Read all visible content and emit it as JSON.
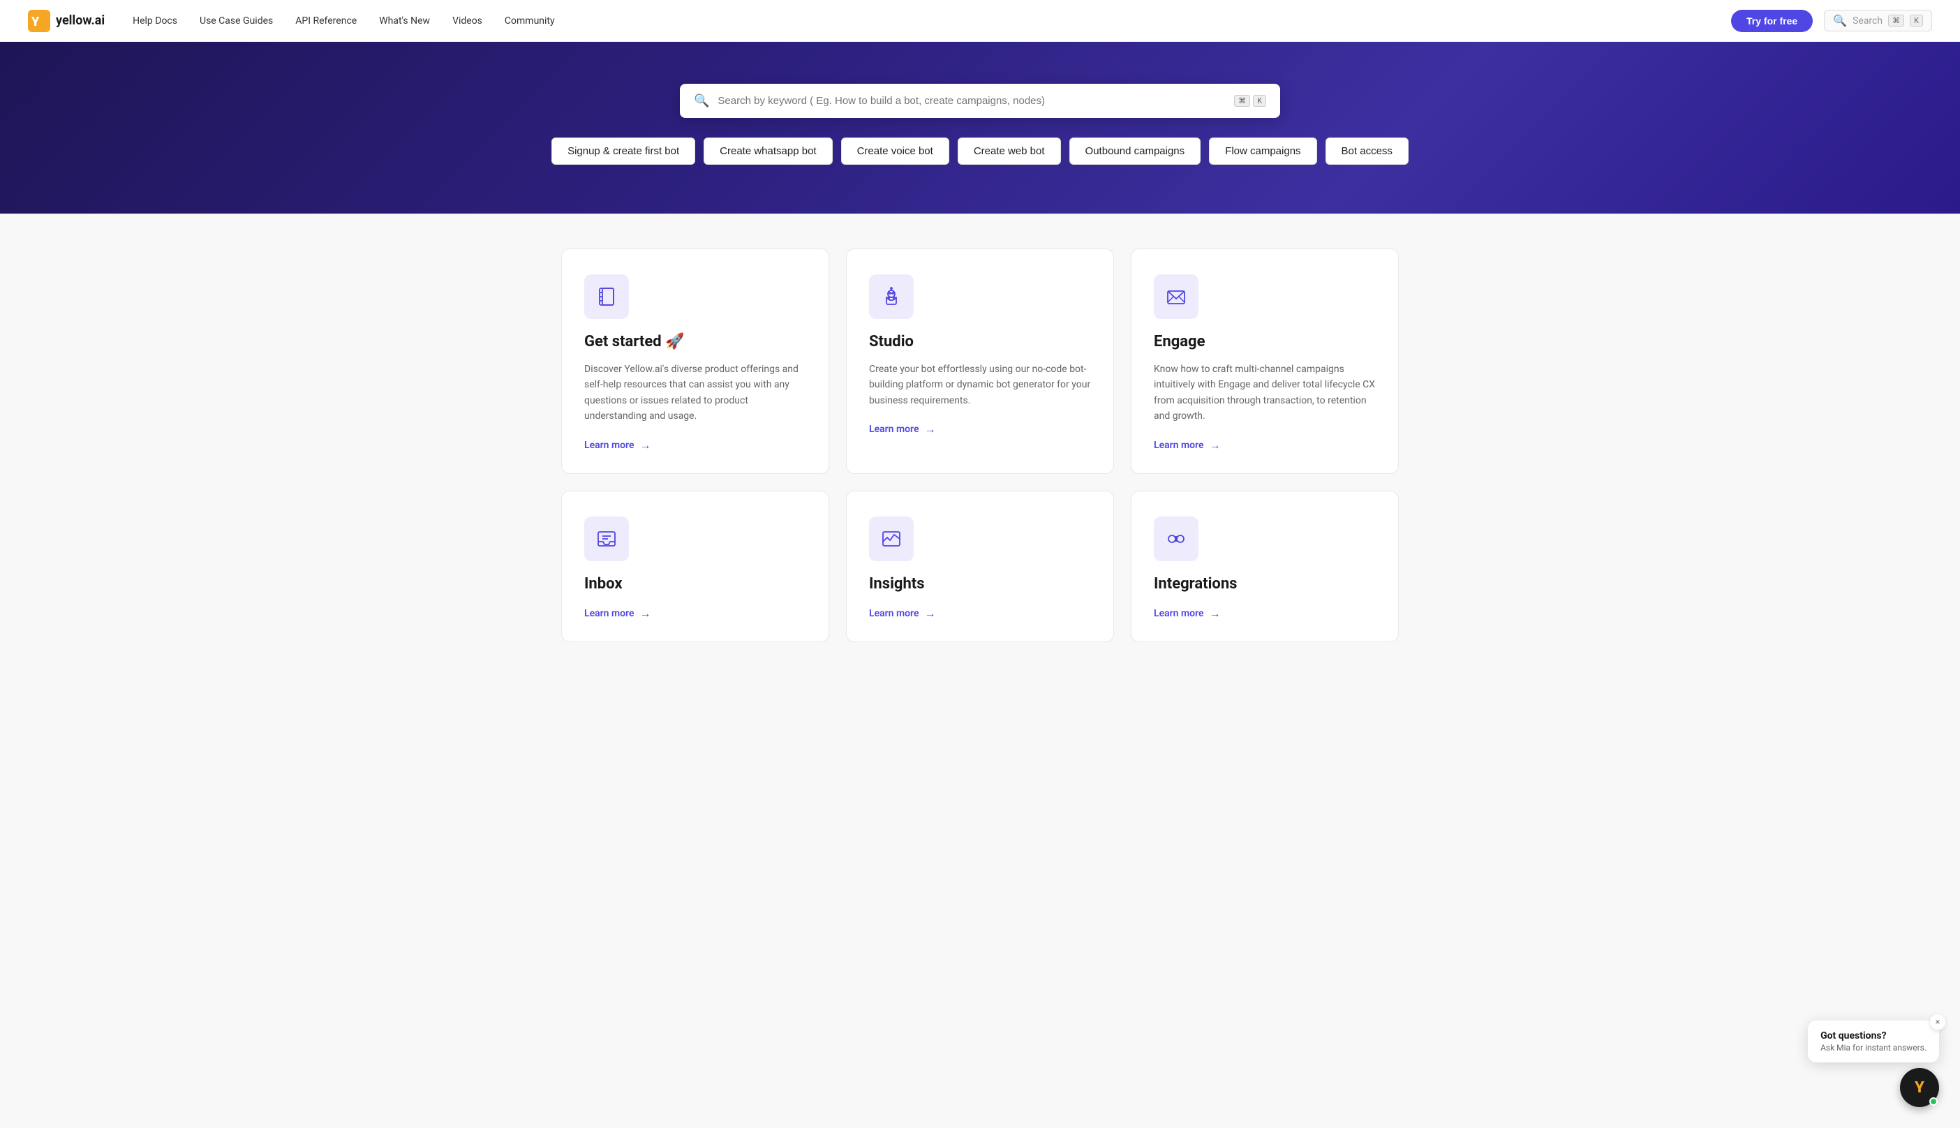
{
  "brand": {
    "logo_text": "yellow.ai",
    "logo_y": "Y"
  },
  "navbar": {
    "links": [
      {
        "label": "Help Docs"
      },
      {
        "label": "Use Case Guides"
      },
      {
        "label": "API Reference"
      },
      {
        "label": "What's New"
      },
      {
        "label": "Videos"
      },
      {
        "label": "Community"
      }
    ],
    "try_btn": "Try for free",
    "search_placeholder": "Search",
    "kbd1": "⌘",
    "kbd2": "K"
  },
  "hero": {
    "search_placeholder": "Search by keyword ( Eg. How to build a bot, create campaigns, nodes)",
    "kbd1": "⌘",
    "kbd2": "K",
    "tags": [
      {
        "label": "Signup & create first bot"
      },
      {
        "label": "Create whatsapp bot"
      },
      {
        "label": "Create voice bot"
      },
      {
        "label": "Create web bot"
      },
      {
        "label": "Outbound campaigns"
      },
      {
        "label": "Flow campaigns"
      },
      {
        "label": "Bot access"
      }
    ]
  },
  "cards": [
    {
      "icon_type": "notebook",
      "title": "Get started 🚀",
      "desc": "Discover Yellow.ai's diverse product offerings and self-help resources that can assist you with any questions or issues related to product understanding and usage.",
      "link": "Learn more"
    },
    {
      "icon_type": "robot",
      "title": "Studio",
      "desc": "Create your bot effortlessly using our no-code bot-building platform or dynamic bot generator for your business requirements.",
      "link": "Learn more"
    },
    {
      "icon_type": "engage",
      "title": "Engage",
      "desc": "Know how to craft multi-channel campaigns intuitively with Engage and deliver total lifecycle CX from acquisition through transaction, to retention and growth.",
      "link": "Learn more"
    },
    {
      "icon_type": "inbox",
      "title": "Inbox",
      "desc": "",
      "link": "Learn more"
    },
    {
      "icon_type": "insights",
      "title": "Insights",
      "desc": "",
      "link": "Learn more"
    },
    {
      "icon_type": "integrations",
      "title": "Integrations",
      "desc": "",
      "link": "Learn more"
    }
  ],
  "chat_widget": {
    "title": "Got questions?",
    "subtitle": "Ask Mia for instant answers.",
    "avatar_letter": "Y",
    "close_icon": "×"
  }
}
